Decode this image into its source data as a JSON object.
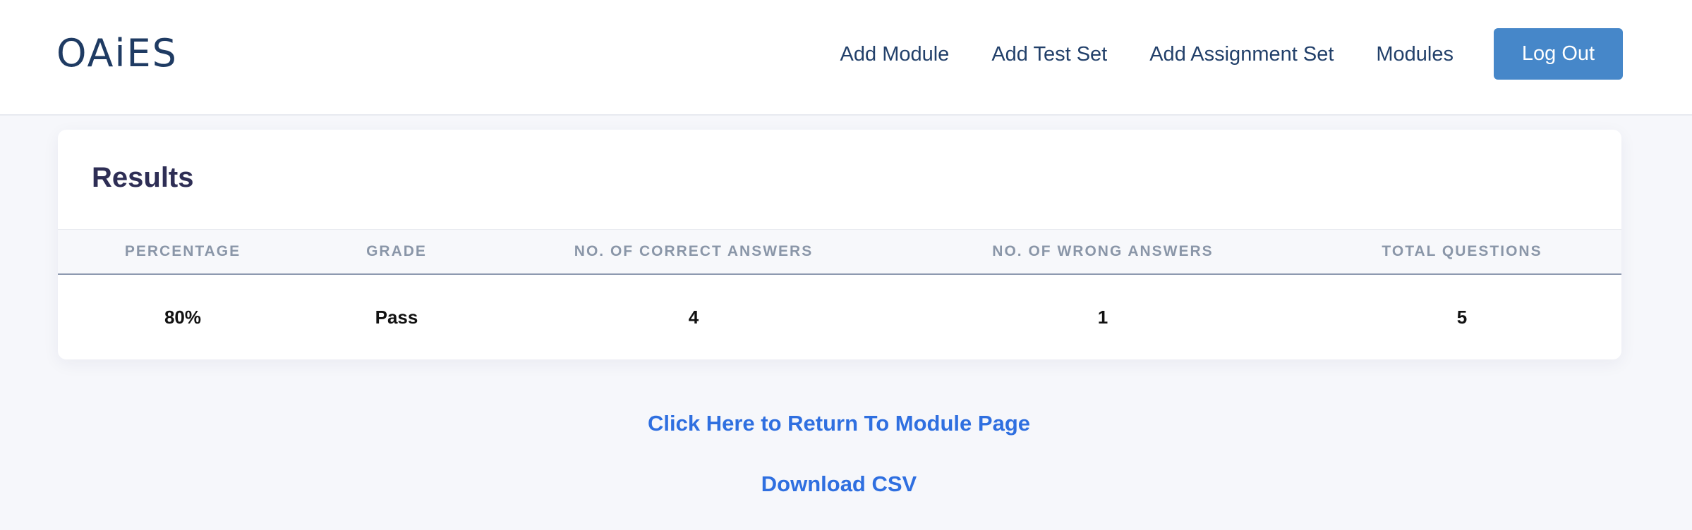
{
  "header": {
    "brand": "OAiES",
    "nav": [
      {
        "label": "Add Module"
      },
      {
        "label": "Add Test Set"
      },
      {
        "label": "Add Assignment Set"
      },
      {
        "label": "Modules"
      }
    ],
    "logout_label": "Log Out"
  },
  "results": {
    "title": "Results",
    "columns": [
      "PERCENTAGE",
      "GRADE",
      "NO. OF CORRECT ANSWERS",
      "NO. OF WRONG ANSWERS",
      "TOTAL QUESTIONS"
    ],
    "row": [
      "80%",
      "Pass",
      "4",
      "1",
      "5"
    ]
  },
  "links": {
    "return_label": "Click Here to Return To Module Page",
    "csv_label": "Download CSV"
  },
  "colors": {
    "accent": "#4687c9",
    "link": "#2f6fe0",
    "brand": "#1f3b63"
  }
}
